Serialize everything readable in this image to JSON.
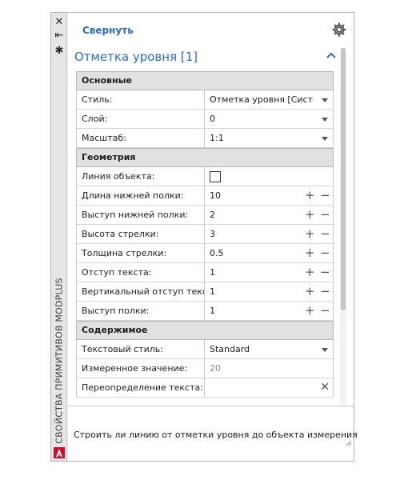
{
  "window": {
    "title": "Свойства примитивов modPLUS",
    "buttons": {
      "close": "✕",
      "autohide": "⇤",
      "properties": "✱"
    }
  },
  "toolbar": {
    "collapse_label": "Свернуть"
  },
  "object": {
    "title": "Отметка уровня [1]"
  },
  "sections": {
    "basic": {
      "title": "Основные",
      "rows": [
        {
          "label": "Стиль:",
          "value": "Отметка уровня [Систем"
        },
        {
          "label": "Слой:",
          "value": "0"
        },
        {
          "label": "Масштаб:",
          "value": "1:1"
        }
      ]
    },
    "geometry": {
      "title": "Геометрия",
      "rows": [
        {
          "label": "Линия объекта:",
          "value": ""
        },
        {
          "label": "Длина нижней полки:",
          "value": "10"
        },
        {
          "label": "Выступ нижней полки:",
          "value": "2"
        },
        {
          "label": "Высота стрелки:",
          "value": "3"
        },
        {
          "label": "Толщина стрелки:",
          "value": "0.5"
        },
        {
          "label": "Отступ текста:",
          "value": "1"
        },
        {
          "label": "Вертикальный отступ текст",
          "value": "1"
        },
        {
          "label": "Выступ полки:",
          "value": "1"
        }
      ]
    },
    "content": {
      "title": "Содержимое",
      "rows": [
        {
          "label": "Текстовый стиль:",
          "value": "Standard"
        },
        {
          "label": "Измеренное значение:",
          "value": "20"
        },
        {
          "label": "Переопределение текста:",
          "value": ""
        }
      ]
    }
  },
  "stepper": {
    "plus": "+",
    "minus": "−"
  },
  "clear_symbol": "✕",
  "hint": {
    "text": "Строить ли линию от отметки уровня до объекта измерения"
  },
  "colors": {
    "accent": "#2a6ebd",
    "logo": "#c8102e"
  },
  "icons": [
    "close-icon",
    "autohide-icon",
    "properties-icon",
    "gear-icon",
    "chevron-up-icon",
    "autocad-logo-icon"
  ]
}
